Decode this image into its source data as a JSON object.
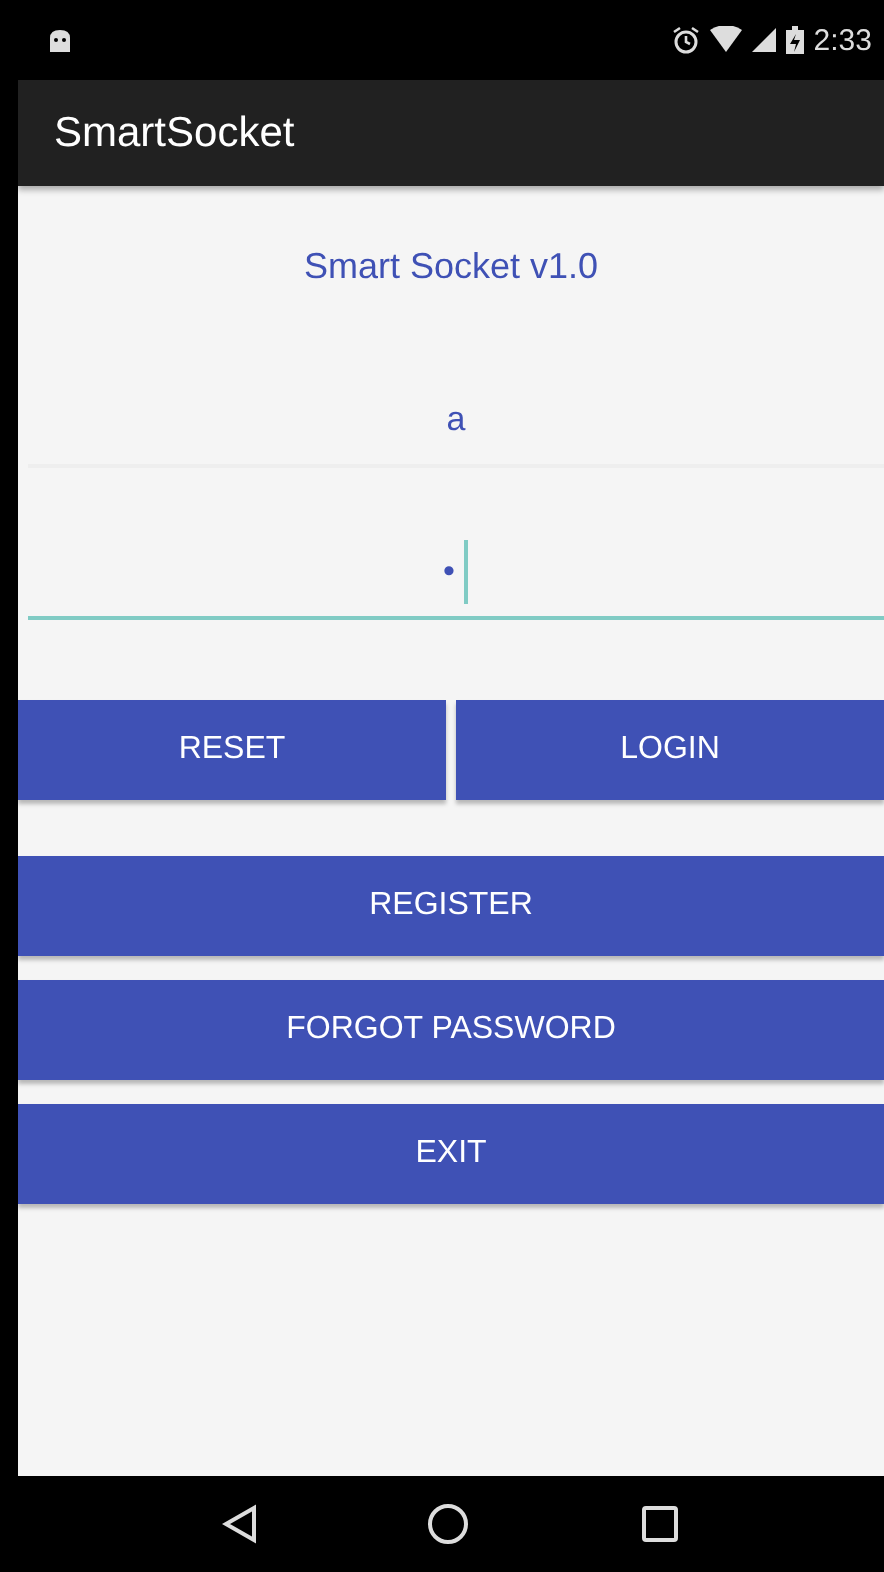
{
  "status_bar": {
    "time": "2:33"
  },
  "app_bar": {
    "title": "SmartSocket"
  },
  "heading": "Smart Socket v1.0",
  "fields": [
    {
      "kind": "username",
      "value": "a",
      "focused": false
    },
    {
      "kind": "password",
      "value": "•",
      "focused": true
    }
  ],
  "button_rows": [
    [
      "RESET",
      "LOGIN"
    ],
    [
      "REGISTER"
    ],
    [
      "FORGOT PASSWORD"
    ],
    [
      "EXIT"
    ]
  ]
}
